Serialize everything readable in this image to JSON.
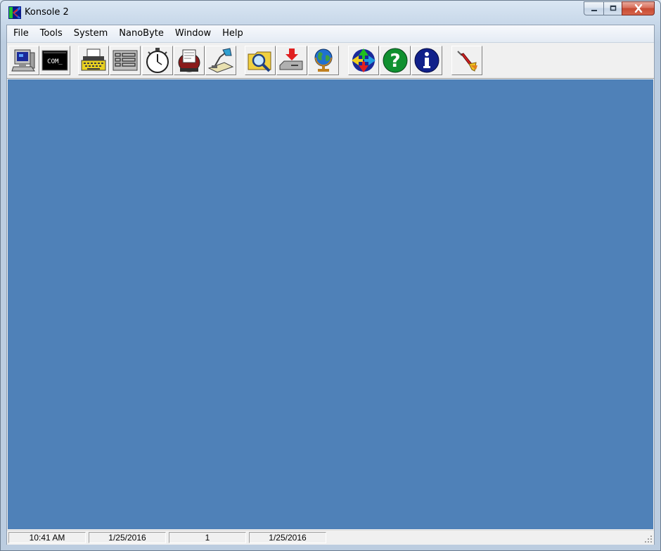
{
  "window": {
    "title": "Konsole 2"
  },
  "caption": {
    "minimize": "–",
    "maximize": "□",
    "close": "✕"
  },
  "menu": [
    "File",
    "Tools",
    "System",
    "NanoByte",
    "Window",
    "Help"
  ],
  "toolbar": {
    "buttons": [
      {
        "icon": "computer-icon"
      },
      {
        "icon": "com-terminal-icon",
        "label": "COM_"
      },
      {
        "icon": "typewriter-icon"
      },
      {
        "icon": "list-icon"
      },
      {
        "icon": "stopwatch-icon"
      },
      {
        "icon": "rolodex-icon"
      },
      {
        "icon": "drafting-lamp-icon"
      },
      {
        "icon": "folder-search-icon"
      },
      {
        "icon": "download-icon"
      },
      {
        "icon": "globe-icon"
      },
      {
        "icon": "transfer-arrows-icon"
      },
      {
        "icon": "help-icon"
      },
      {
        "icon": "info-icon"
      },
      {
        "icon": "dart-icon"
      }
    ]
  },
  "colors": {
    "workspace": "#4f81b8"
  },
  "status": {
    "time": "10:41 AM",
    "date1": "1/25/2016",
    "count": "1",
    "date2": "1/25/2016"
  }
}
